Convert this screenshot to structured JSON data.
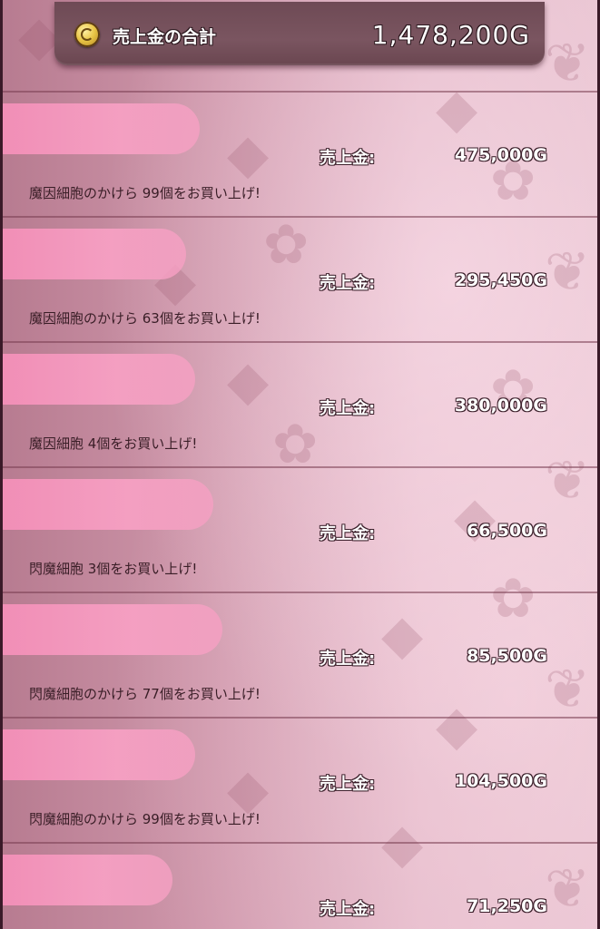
{
  "header": {
    "total_label": "売上金の合計",
    "total_value": "1,478,200G",
    "coin_icon": "gold-coin-icon"
  },
  "sale_label": "売上金:",
  "sales": [
    {
      "name": "",
      "amount": "475,000G",
      "message": "魔因細胞のかけら 99個をお買い上げ!"
    },
    {
      "name": "",
      "amount": "295,450G",
      "message": "魔因細胞のかけら 63個をお買い上げ!"
    },
    {
      "name": "",
      "amount": "380,000G",
      "message": "魔因細胞 4個をお買い上げ!"
    },
    {
      "name": "",
      "amount": "66,500G",
      "message": "閃魔細胞 3個をお買い上げ!"
    },
    {
      "name": "",
      "amount": "85,500G",
      "message": "閃魔細胞のかけら 77個をお買い上げ!"
    },
    {
      "name": "",
      "amount": "104,500G",
      "message": "閃魔細胞のかけら 99個をお買い上げ!"
    },
    {
      "name": "",
      "amount": "71,250G",
      "message": ""
    }
  ],
  "colors": {
    "redaction": "#f48fb8",
    "background": "#d9a4b6",
    "panel": "#74505b"
  }
}
